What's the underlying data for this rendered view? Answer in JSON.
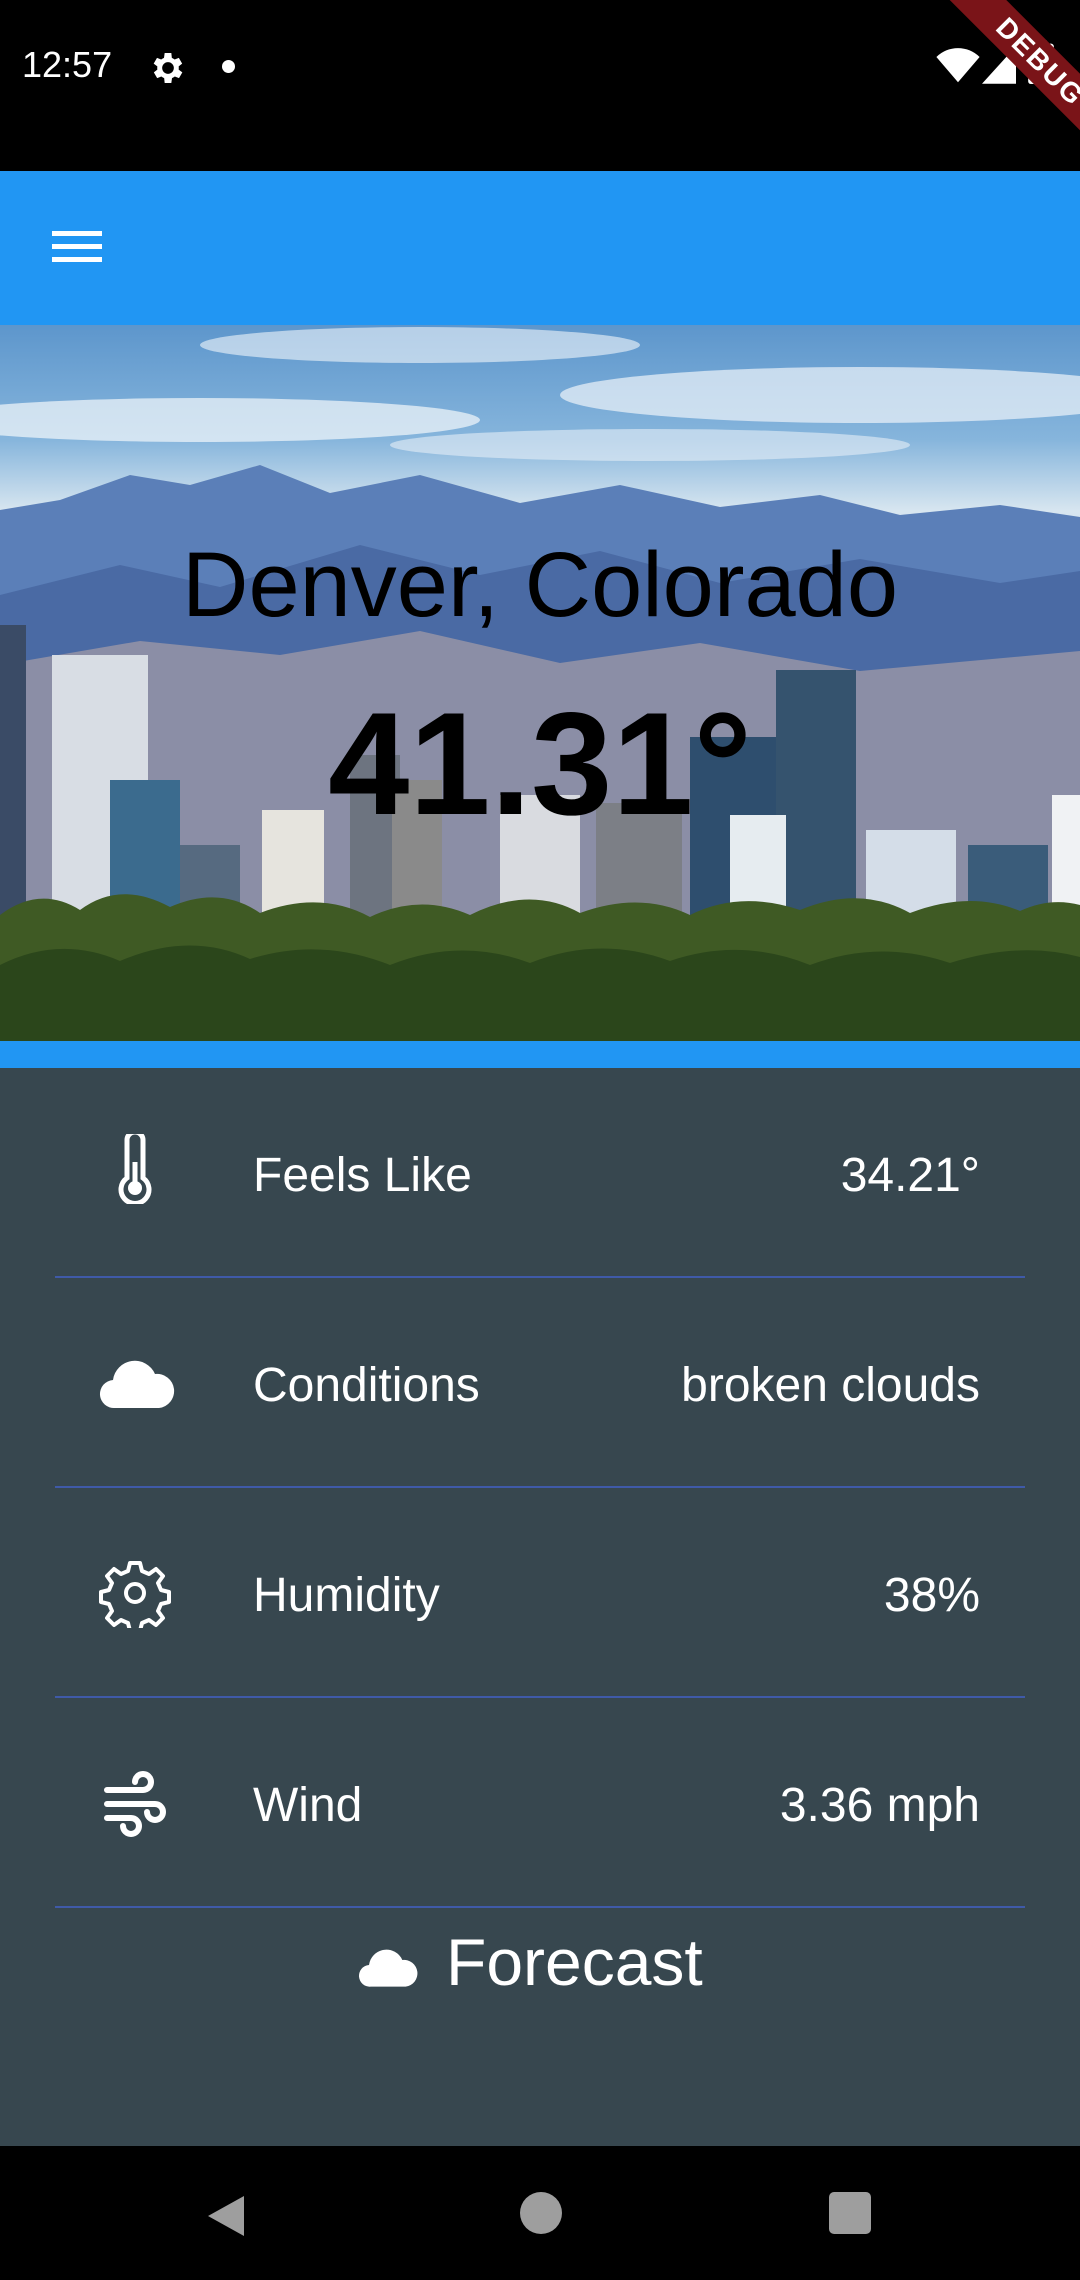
{
  "status_bar": {
    "time": "12:57",
    "debug_label": "DEBUG",
    "icons": [
      "gear-icon",
      "notification-dot-icon",
      "wifi-icon",
      "signal-icon",
      "battery-icon"
    ]
  },
  "app_bar": {
    "menu_icon": "hamburger-menu-icon",
    "color": "#2196f3"
  },
  "hero": {
    "city": "Denver, Colorado",
    "temperature": "41.31°",
    "background": "denver-skyline-image"
  },
  "details": [
    {
      "icon": "thermometer-icon",
      "label": "Feels Like",
      "value": "34.21°"
    },
    {
      "icon": "cloud-icon",
      "label": "Conditions",
      "value": "broken clouds"
    },
    {
      "icon": "gear-icon",
      "label": "Humidity",
      "value": "38%"
    },
    {
      "icon": "wind-icon",
      "label": "Wind",
      "value": "3.36 mph"
    }
  ],
  "forecast_button": {
    "icon": "cloud-icon",
    "label": "Forecast"
  },
  "nav_bar": {
    "icons": [
      "back-icon",
      "home-icon",
      "recent-apps-icon"
    ]
  },
  "colors": {
    "panel": "#37474f",
    "accent": "#2196f3",
    "divider": "#3f5aa8"
  }
}
